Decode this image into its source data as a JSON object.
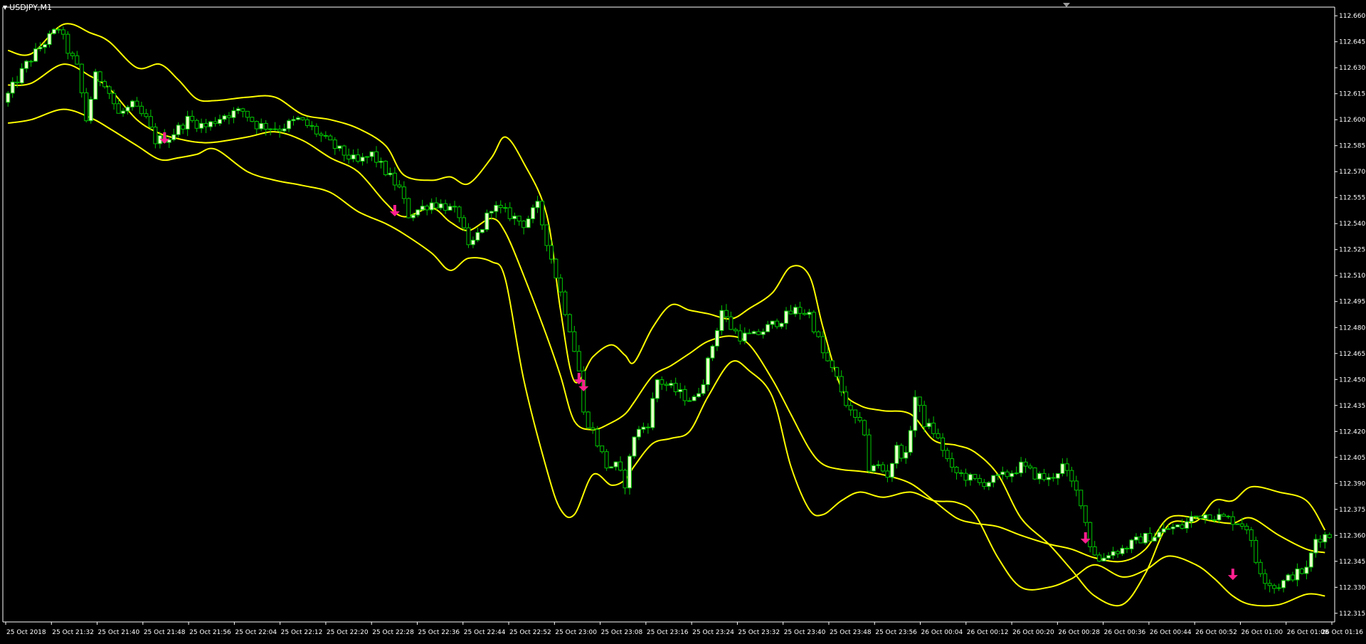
{
  "window": {
    "symbol_title": "USDJPY,M1"
  },
  "colors": {
    "background": "#000000",
    "frame": "#ffffff",
    "candle_bull_body": "#e6ffc8",
    "candle_bear_body": "#000000",
    "candle_wick": "#00c800",
    "bands": "#ffff00",
    "arrow": "#ff1f8f",
    "text": "#ffffff"
  },
  "chart_data": {
    "type": "candlestick",
    "indicator": "Bollinger Bands",
    "ylim": [
      112.31,
      112.665
    ],
    "y_ticks": [
      "112.660",
      "112.645",
      "112.630",
      "112.615",
      "112.600",
      "112.585",
      "112.570",
      "112.555",
      "112.540",
      "112.525",
      "112.510",
      "112.495",
      "112.480",
      "112.465",
      "112.450",
      "112.435",
      "112.420",
      "112.405",
      "112.390",
      "112.375",
      "112.360",
      "112.345",
      "112.330",
      "112.315"
    ],
    "x_labels": [
      "25 Oct 2018",
      "25 Oct 21:32",
      "25 Oct 21:40",
      "25 Oct 21:48",
      "25 Oct 21:56",
      "25 Oct 22:04",
      "25 Oct 22:12",
      "25 Oct 22:20",
      "25 Oct 22:28",
      "25 Oct 22:36",
      "25 Oct 22:44",
      "25 Oct 22:52",
      "25 Oct 23:00",
      "25 Oct 23:08",
      "25 Oct 23:16",
      "25 Oct 23:24",
      "25 Oct 23:32",
      "25 Oct 23:40",
      "25 Oct 23:48",
      "25 Oct 23:56",
      "26 Oct 00:04",
      "26 Oct 00:12",
      "26 Oct 00:20",
      "26 Oct 00:28",
      "26 Oct 00:36",
      "26 Oct 00:44",
      "26 Oct 00:52",
      "26 Oct 01:00",
      "26 Oct 01:08",
      "26 Oct 01:16"
    ],
    "bands": {
      "upper": [
        [
          0,
          112.64
        ],
        [
          5,
          112.638
        ],
        [
          12,
          112.655
        ],
        [
          18,
          112.65
        ],
        [
          22,
          112.645
        ],
        [
          28,
          112.63
        ],
        [
          33,
          112.632
        ],
        [
          37,
          112.623
        ],
        [
          41,
          112.612
        ],
        [
          45,
          112.611
        ],
        [
          52,
          112.613
        ],
        [
          58,
          112.613
        ],
        [
          64,
          112.603
        ],
        [
          70,
          112.6
        ],
        [
          76,
          112.595
        ],
        [
          82,
          112.585
        ],
        [
          86,
          112.568
        ],
        [
          92,
          112.565
        ],
        [
          96,
          112.567
        ],
        [
          100,
          112.563
        ],
        [
          105,
          112.578
        ],
        [
          108,
          112.59
        ],
        [
          112,
          112.575
        ],
        [
          117,
          112.545
        ],
        [
          120,
          112.49
        ],
        [
          123,
          112.449
        ],
        [
          127,
          112.463
        ],
        [
          131,
          112.47
        ],
        [
          134,
          112.464
        ],
        [
          136,
          112.46
        ],
        [
          140,
          112.48
        ],
        [
          144,
          112.493
        ],
        [
          148,
          112.49
        ],
        [
          152,
          112.488
        ],
        [
          157,
          112.485
        ],
        [
          161,
          112.491
        ],
        [
          166,
          112.5
        ],
        [
          170,
          112.515
        ],
        [
          174,
          112.51
        ],
        [
          177,
          112.48
        ],
        [
          181,
          112.445
        ],
        [
          185,
          112.435
        ],
        [
          190,
          112.432
        ],
        [
          196,
          112.43
        ],
        [
          201,
          112.415
        ],
        [
          206,
          112.412
        ],
        [
          210,
          112.408
        ],
        [
          215,
          112.395
        ],
        [
          220,
          112.37
        ],
        [
          226,
          112.355
        ],
        [
          231,
          112.34
        ],
        [
          236,
          112.325
        ],
        [
          242,
          112.32
        ],
        [
          247,
          112.338
        ],
        [
          252,
          112.366
        ],
        [
          258,
          112.368
        ],
        [
          262,
          112.38
        ],
        [
          266,
          112.38
        ],
        [
          270,
          112.388
        ],
        [
          276,
          112.385
        ],
        [
          282,
          112.38
        ],
        [
          286,
          112.363
        ]
      ],
      "middle": [
        [
          0,
          112.62
        ],
        [
          5,
          112.621
        ],
        [
          12,
          112.632
        ],
        [
          18,
          112.625
        ],
        [
          22,
          112.618
        ],
        [
          28,
          112.6
        ],
        [
          33,
          112.592
        ],
        [
          37,
          112.589
        ],
        [
          41,
          112.587
        ],
        [
          45,
          112.587
        ],
        [
          52,
          112.59
        ],
        [
          58,
          112.593
        ],
        [
          64,
          112.588
        ],
        [
          70,
          112.578
        ],
        [
          76,
          112.57
        ],
        [
          82,
          112.552
        ],
        [
          86,
          112.544
        ],
        [
          92,
          112.549
        ],
        [
          96,
          112.541
        ],
        [
          100,
          112.536
        ],
        [
          105,
          112.543
        ],
        [
          108,
          112.535
        ],
        [
          112,
          112.51
        ],
        [
          117,
          112.475
        ],
        [
          120,
          112.452
        ],
        [
          123,
          112.426
        ],
        [
          127,
          112.421
        ],
        [
          131,
          112.425
        ],
        [
          134,
          112.43
        ],
        [
          136,
          112.437
        ],
        [
          140,
          112.452
        ],
        [
          144,
          112.458
        ],
        [
          148,
          112.465
        ],
        [
          152,
          112.472
        ],
        [
          157,
          112.475
        ],
        [
          161,
          112.47
        ],
        [
          166,
          112.45
        ],
        [
          170,
          112.43
        ],
        [
          174,
          112.41
        ],
        [
          177,
          112.401
        ],
        [
          181,
          112.398
        ],
        [
          185,
          112.397
        ],
        [
          190,
          112.395
        ],
        [
          196,
          112.39
        ],
        [
          201,
          112.38
        ],
        [
          206,
          112.37
        ],
        [
          210,
          112.367
        ],
        [
          215,
          112.365
        ],
        [
          220,
          112.36
        ],
        [
          226,
          112.355
        ],
        [
          231,
          112.352
        ],
        [
          236,
          112.347
        ],
        [
          242,
          112.345
        ],
        [
          247,
          112.352
        ],
        [
          252,
          112.37
        ],
        [
          258,
          112.37
        ],
        [
          262,
          112.368
        ],
        [
          266,
          112.367
        ],
        [
          270,
          112.37
        ],
        [
          276,
          112.36
        ],
        [
          282,
          112.352
        ],
        [
          286,
          112.35
        ]
      ],
      "lower": [
        [
          0,
          112.598
        ],
        [
          5,
          112.6
        ],
        [
          12,
          112.606
        ],
        [
          18,
          112.601
        ],
        [
          22,
          112.595
        ],
        [
          28,
          112.585
        ],
        [
          33,
          112.577
        ],
        [
          37,
          112.578
        ],
        [
          41,
          112.58
        ],
        [
          45,
          112.583
        ],
        [
          52,
          112.57
        ],
        [
          58,
          112.565
        ],
        [
          64,
          112.562
        ],
        [
          70,
          112.558
        ],
        [
          76,
          112.547
        ],
        [
          82,
          112.54
        ],
        [
          86,
          112.534
        ],
        [
          92,
          112.523
        ],
        [
          96,
          112.513
        ],
        [
          100,
          112.52
        ],
        [
          105,
          112.518
        ],
        [
          108,
          112.508
        ],
        [
          112,
          112.45
        ],
        [
          117,
          112.398
        ],
        [
          120,
          112.375
        ],
        [
          123,
          112.372
        ],
        [
          127,
          112.395
        ],
        [
          131,
          112.389
        ],
        [
          134,
          112.392
        ],
        [
          136,
          112.4
        ],
        [
          140,
          112.413
        ],
        [
          144,
          112.416
        ],
        [
          148,
          112.42
        ],
        [
          152,
          112.44
        ],
        [
          157,
          112.46
        ],
        [
          161,
          112.455
        ],
        [
          166,
          112.44
        ],
        [
          170,
          112.4
        ],
        [
          174,
          112.375
        ],
        [
          177,
          112.372
        ],
        [
          181,
          112.38
        ],
        [
          185,
          112.385
        ],
        [
          190,
          112.382
        ],
        [
          196,
          112.385
        ],
        [
          201,
          112.38
        ],
        [
          206,
          112.379
        ],
        [
          210,
          112.372
        ],
        [
          215,
          112.347
        ],
        [
          220,
          112.33
        ],
        [
          226,
          112.33
        ],
        [
          231,
          112.335
        ],
        [
          236,
          112.343
        ],
        [
          242,
          112.336
        ],
        [
          247,
          112.34
        ],
        [
          252,
          112.348
        ],
        [
          258,
          112.343
        ],
        [
          262,
          112.335
        ],
        [
          266,
          112.325
        ],
        [
          270,
          112.32
        ],
        [
          276,
          112.32
        ],
        [
          282,
          112.326
        ],
        [
          286,
          112.325
        ]
      ]
    },
    "price_anchors": [
      [
        0,
        112.61
      ],
      [
        5,
        112.632
      ],
      [
        8,
        112.642
      ],
      [
        12,
        112.653
      ],
      [
        14,
        112.64
      ],
      [
        16,
        112.63
      ],
      [
        18,
        112.6
      ],
      [
        20,
        112.625
      ],
      [
        22,
        112.622
      ],
      [
        25,
        112.603
      ],
      [
        28,
        112.608
      ],
      [
        31,
        112.6
      ],
      [
        33,
        112.588
      ],
      [
        36,
        112.59
      ],
      [
        40,
        112.6
      ],
      [
        44,
        112.596
      ],
      [
        48,
        112.603
      ],
      [
        52,
        112.605
      ],
      [
        55,
        112.597
      ],
      [
        60,
        112.595
      ],
      [
        64,
        112.6
      ],
      [
        67,
        112.595
      ],
      [
        70,
        112.588
      ],
      [
        73,
        112.582
      ],
      [
        77,
        112.575
      ],
      [
        80,
        112.58
      ],
      [
        83,
        112.57
      ],
      [
        86,
        112.56
      ],
      [
        88,
        112.545
      ],
      [
        90,
        112.548
      ],
      [
        93,
        112.552
      ],
      [
        96,
        112.55
      ],
      [
        99,
        112.545
      ],
      [
        101,
        112.525
      ],
      [
        104,
        112.538
      ],
      [
        106,
        112.55
      ],
      [
        110,
        112.545
      ],
      [
        113,
        112.54
      ],
      [
        116,
        112.55
      ],
      [
        118,
        112.53
      ],
      [
        121,
        112.5
      ],
      [
        123,
        112.48
      ],
      [
        125,
        112.455
      ],
      [
        126,
        112.43
      ],
      [
        128,
        112.42
      ],
      [
        131,
        112.4
      ],
      [
        133,
        112.4
      ],
      [
        135,
        112.39
      ],
      [
        137,
        112.418
      ],
      [
        140,
        112.425
      ],
      [
        142,
        112.45
      ],
      [
        145,
        112.445
      ],
      [
        148,
        112.44
      ],
      [
        150,
        112.438
      ],
      [
        152,
        112.45
      ],
      [
        154,
        112.47
      ],
      [
        156,
        112.49
      ],
      [
        158,
        112.48
      ],
      [
        160,
        112.475
      ],
      [
        163,
        112.475
      ],
      [
        166,
        112.48
      ],
      [
        169,
        112.485
      ],
      [
        172,
        112.49
      ],
      [
        175,
        112.488
      ],
      [
        178,
        112.465
      ],
      [
        181,
        112.45
      ],
      [
        184,
        112.43
      ],
      [
        187,
        112.42
      ],
      [
        188,
        112.398
      ],
      [
        190,
        112.4
      ],
      [
        192,
        112.395
      ],
      [
        194,
        112.41
      ],
      [
        196,
        112.405
      ],
      [
        198,
        112.44
      ],
      [
        200,
        112.425
      ],
      [
        202,
        112.42
      ],
      [
        204,
        112.41
      ],
      [
        206,
        112.397
      ],
      [
        209,
        112.394
      ],
      [
        212,
        112.39
      ],
      [
        215,
        112.392
      ],
      [
        218,
        112.395
      ],
      [
        221,
        112.4
      ],
      [
        224,
        112.395
      ],
      [
        227,
        112.392
      ],
      [
        230,
        112.4
      ],
      [
        232,
        112.39
      ],
      [
        234,
        112.38
      ],
      [
        236,
        112.355
      ],
      [
        238,
        112.345
      ],
      [
        240,
        112.35
      ],
      [
        243,
        112.352
      ],
      [
        247,
        112.358
      ],
      [
        250,
        112.36
      ],
      [
        253,
        112.364
      ],
      [
        256,
        112.365
      ],
      [
        258,
        112.37
      ],
      [
        260,
        112.372
      ],
      [
        262,
        112.372
      ],
      [
        265,
        112.37
      ],
      [
        268,
        112.368
      ],
      [
        270,
        112.365
      ],
      [
        272,
        112.345
      ],
      [
        274,
        112.335
      ],
      [
        276,
        112.33
      ],
      [
        278,
        112.333
      ],
      [
        280,
        112.337
      ],
      [
        283,
        112.34
      ],
      [
        285,
        112.358
      ],
      [
        287,
        112.36
      ]
    ],
    "sell_signals": [
      [
        34,
        112.587
      ],
      [
        84,
        112.545
      ],
      [
        124,
        112.448
      ],
      [
        125,
        112.444
      ],
      [
        234,
        112.356
      ],
      [
        266,
        112.335
      ]
    ]
  }
}
